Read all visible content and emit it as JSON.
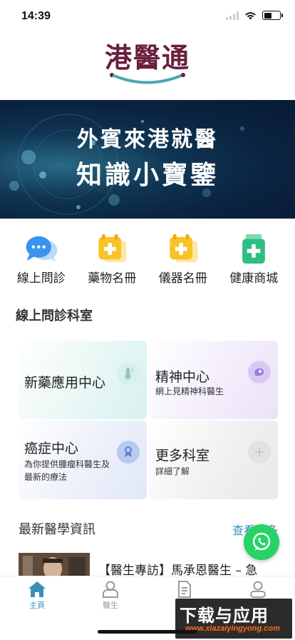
{
  "status_bar": {
    "time": "14:39"
  },
  "logo": {
    "text": "港醫通"
  },
  "banner": {
    "line1": "外賓來港就醫",
    "line2": "知識小寶鑒"
  },
  "quick_menu": [
    {
      "label": "線上問診",
      "icon": "chat-bubbles-icon"
    },
    {
      "label": "藥物名冊",
      "icon": "medicine-folder-icon"
    },
    {
      "label": "儀器名冊",
      "icon": "device-folder-icon"
    },
    {
      "label": "健康商城",
      "icon": "medicine-bottle-icon"
    }
  ],
  "departments": {
    "title": "線上問診科室",
    "cards": [
      {
        "name": "新藥應用中心",
        "desc": "",
        "icon": "thermometer-icon",
        "color": "#d6f0ee"
      },
      {
        "name": "精神中心",
        "desc": "網上見精神科醫生",
        "icon": "mind-icon",
        "color": "#d9c9f2"
      },
      {
        "name": "癌症中心",
        "desc": "為你提供腫瘤科醫生及最新的療法",
        "icon": "ribbon-icon",
        "color": "#b9c9ef"
      },
      {
        "name": "更多科室",
        "desc": "詳細了解",
        "icon": "plus-icon",
        "color": "#dcdcdc"
      }
    ]
  },
  "news": {
    "title": "最新醫學資訊",
    "more": "查看更多",
    "items": [
      {
        "headline": "【醫生專訪】馬承恩醫生 – 急"
      }
    ]
  },
  "tab_bar": [
    {
      "label": "主頁",
      "icon": "home-icon",
      "active": true
    },
    {
      "label": "醫生",
      "icon": "doctor-icon",
      "active": false
    },
    {
      "label": "",
      "icon": "document-icon",
      "active": false
    },
    {
      "label": "",
      "icon": "user-icon",
      "active": false
    }
  ],
  "watermark": {
    "text": "下载与应用",
    "url": "www.xiazaiyingyong.com"
  },
  "colors": {
    "brand": "#6b1f3c",
    "accent": "#3a8fb7",
    "whatsapp": "#25d366"
  }
}
